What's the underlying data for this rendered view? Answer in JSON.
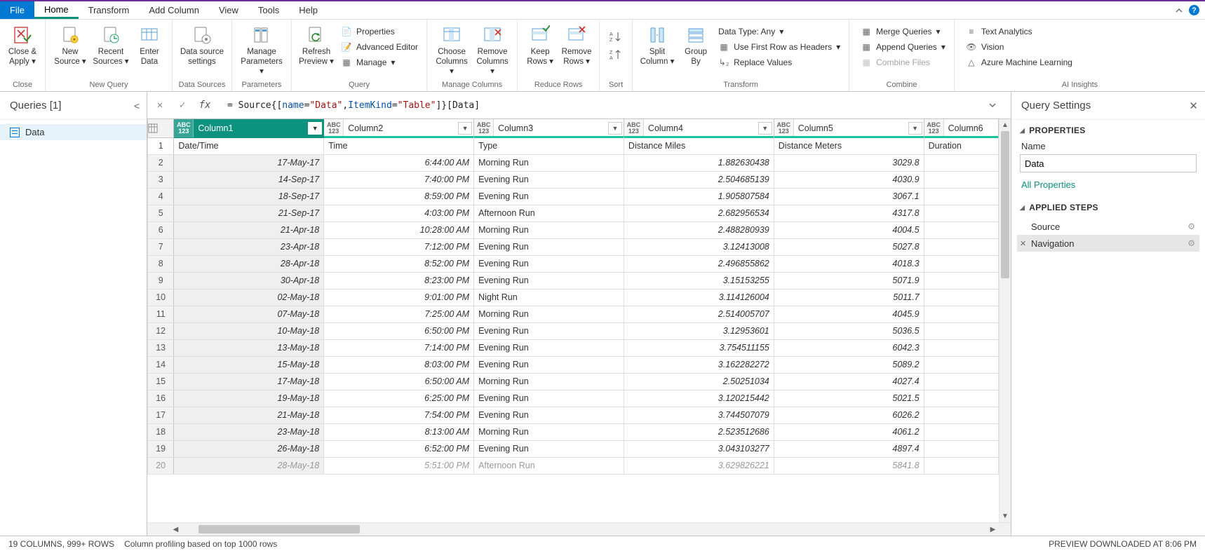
{
  "menubar": {
    "tabs": [
      "File",
      "Home",
      "Transform",
      "Add Column",
      "View",
      "Tools",
      "Help"
    ],
    "active_index": 1
  },
  "ribbon": {
    "groups": {
      "close": {
        "label": "Close",
        "buttons": [
          {
            "id": "close-apply",
            "text": "Close &\nApply",
            "dd": true
          }
        ]
      },
      "newquery": {
        "label": "New Query",
        "buttons": [
          {
            "id": "new-source",
            "text": "New\nSource",
            "dd": true
          },
          {
            "id": "recent-sources",
            "text": "Recent\nSources",
            "dd": true
          },
          {
            "id": "enter-data",
            "text": "Enter\nData"
          }
        ]
      },
      "datasources": {
        "label": "Data Sources",
        "buttons": [
          {
            "id": "data-source-settings",
            "text": "Data source\nsettings"
          }
        ]
      },
      "parameters": {
        "label": "Parameters",
        "buttons": [
          {
            "id": "manage-parameters",
            "text": "Manage\nParameters",
            "dd": true
          }
        ]
      },
      "query": {
        "label": "Query",
        "big": [
          {
            "id": "refresh-preview",
            "text": "Refresh\nPreview",
            "dd": true
          }
        ],
        "minis": [
          {
            "id": "properties",
            "text": "Properties"
          },
          {
            "id": "advanced-editor",
            "text": "Advanced Editor"
          },
          {
            "id": "manage",
            "text": "Manage",
            "dd": true
          }
        ]
      },
      "managecolumns": {
        "label": "Manage Columns",
        "buttons": [
          {
            "id": "choose-columns",
            "text": "Choose\nColumns",
            "dd": true
          },
          {
            "id": "remove-columns",
            "text": "Remove\nColumns",
            "dd": true
          }
        ]
      },
      "reducerows": {
        "label": "Reduce Rows",
        "buttons": [
          {
            "id": "keep-rows",
            "text": "Keep\nRows",
            "dd": true
          },
          {
            "id": "remove-rows",
            "text": "Remove\nRows",
            "dd": true
          }
        ]
      },
      "sort": {
        "label": "Sort"
      },
      "transform": {
        "label": "Transform",
        "big": [
          {
            "id": "split-column",
            "text": "Split\nColumn",
            "dd": true
          },
          {
            "id": "group-by",
            "text": "Group\nBy"
          }
        ],
        "minis": [
          {
            "id": "data-type",
            "text": "Data Type: Any",
            "dd": true
          },
          {
            "id": "first-row-headers",
            "text": "Use First Row as Headers",
            "dd": true
          },
          {
            "id": "replace-values",
            "text": "Replace Values"
          }
        ]
      },
      "combine": {
        "label": "Combine",
        "minis": [
          {
            "id": "merge-queries",
            "text": "Merge Queries",
            "dd": true
          },
          {
            "id": "append-queries",
            "text": "Append Queries",
            "dd": true
          },
          {
            "id": "combine-files",
            "text": "Combine Files",
            "disabled": true
          }
        ]
      },
      "aiinsights": {
        "label": "AI Insights",
        "minis": [
          {
            "id": "text-analytics",
            "text": "Text Analytics"
          },
          {
            "id": "vision",
            "text": "Vision"
          },
          {
            "id": "azure-ml",
            "text": "Azure Machine Learning"
          }
        ]
      }
    }
  },
  "queries_pane": {
    "title": "Queries [1]",
    "items": [
      {
        "name": "Data",
        "selected": true
      }
    ]
  },
  "formula": {
    "prefix": "= Source{[",
    "kw1": "name",
    "eq": "=",
    "str1": "\"Data\"",
    "comma": ",",
    "kw2": "ItemKind",
    "str2": "\"Table\"",
    "suffix": "]}[Data]"
  },
  "grid": {
    "columns": [
      {
        "name": "Column1",
        "selected": true
      },
      {
        "name": "Column2"
      },
      {
        "name": "Column3"
      },
      {
        "name": "Column4"
      },
      {
        "name": "Column5"
      },
      {
        "name": "Column6"
      }
    ],
    "header_row": [
      "Date/Time",
      "Time",
      "Type",
      "Distance Miles",
      "Distance Meters",
      "Duration"
    ],
    "rows": [
      [
        "17-May-17",
        "6:44:00 AM",
        "Morning Run",
        "1.882630438",
        "3029.8",
        ""
      ],
      [
        "14-Sep-17",
        "7:40:00 PM",
        "Evening Run",
        "2.504685139",
        "4030.9",
        ""
      ],
      [
        "18-Sep-17",
        "8:59:00 PM",
        "Evening Run",
        "1.905807584",
        "3067.1",
        ""
      ],
      [
        "21-Sep-17",
        "4:03:00 PM",
        "Afternoon Run",
        "2.682956534",
        "4317.8",
        ""
      ],
      [
        "21-Apr-18",
        "10:28:00 AM",
        "Morning Run",
        "2.488280939",
        "4004.5",
        ""
      ],
      [
        "23-Apr-18",
        "7:12:00 PM",
        "Evening Run",
        "3.12413008",
        "5027.8",
        ""
      ],
      [
        "28-Apr-18",
        "8:52:00 PM",
        "Evening Run",
        "2.496855862",
        "4018.3",
        ""
      ],
      [
        "30-Apr-18",
        "8:23:00 PM",
        "Evening Run",
        "3.15153255",
        "5071.9",
        ""
      ],
      [
        "02-May-18",
        "9:01:00 PM",
        "Night Run",
        "3.114126004",
        "5011.7",
        ""
      ],
      [
        "07-May-18",
        "7:25:00 AM",
        "Morning Run",
        "2.514005707",
        "4045.9",
        ""
      ],
      [
        "10-May-18",
        "6:50:00 PM",
        "Evening Run",
        "3.12953601",
        "5036.5",
        ""
      ],
      [
        "13-May-18",
        "7:14:00 PM",
        "Evening Run",
        "3.754511155",
        "6042.3",
        ""
      ],
      [
        "15-May-18",
        "8:03:00 PM",
        "Evening Run",
        "3.162282272",
        "5089.2",
        ""
      ],
      [
        "17-May-18",
        "6:50:00 AM",
        "Morning Run",
        "2.50251034",
        "4027.4",
        ""
      ],
      [
        "19-May-18",
        "6:25:00 PM",
        "Evening Run",
        "3.120215442",
        "5021.5",
        ""
      ],
      [
        "21-May-18",
        "7:54:00 PM",
        "Evening Run",
        "3.744507079",
        "6026.2",
        ""
      ],
      [
        "23-May-18",
        "8:13:00 AM",
        "Morning Run",
        "2.523512686",
        "4061.2",
        ""
      ],
      [
        "26-May-18",
        "6:52:00 PM",
        "Evening Run",
        "3.043103277",
        "4897.4",
        ""
      ],
      [
        "28-May-18",
        "5:51:00 PM",
        "Afternoon Run",
        "3.629826221",
        "5841.8",
        ""
      ]
    ]
  },
  "query_settings": {
    "title": "Query Settings",
    "properties_label": "PROPERTIES",
    "name_label": "Name",
    "name_value": "Data",
    "all_properties": "All Properties",
    "applied_steps_label": "APPLIED STEPS",
    "steps": [
      {
        "name": "Source",
        "selected": false,
        "gear": true
      },
      {
        "name": "Navigation",
        "selected": true,
        "gear": true
      }
    ]
  },
  "status": {
    "cols_rows": "19 COLUMNS, 999+ ROWS",
    "profiling": "Column profiling based on top 1000 rows",
    "preview": "PREVIEW DOWNLOADED AT 8:06 PM"
  }
}
